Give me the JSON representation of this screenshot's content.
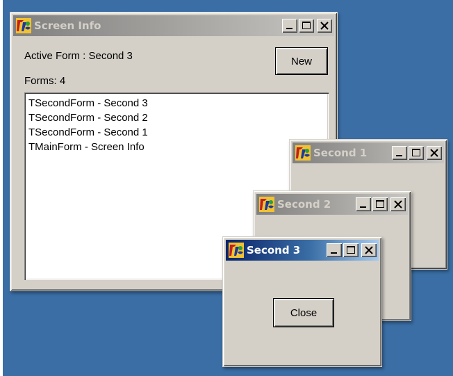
{
  "windows": {
    "screen_info": {
      "title": "Screen Info",
      "active_form_label": "Active Form : Second 3",
      "new_button": "New",
      "forms_count_label": "Forms: 4",
      "forms_list": [
        "TSecondForm - Second 3",
        "TSecondForm - Second 2",
        "TSecondForm - Second 1",
        "TMainForm - Screen Info"
      ]
    },
    "second1": {
      "title": "Second 1"
    },
    "second2": {
      "title": "Second 2"
    },
    "second3": {
      "title": "Second 3",
      "close_button": "Close"
    }
  },
  "colors": {
    "desktop": "#3a6ea5",
    "face": "#d4d0c8",
    "active_title_start": "#0a246a",
    "active_title_end": "#a6caf0",
    "inactive_title": "#808080"
  }
}
